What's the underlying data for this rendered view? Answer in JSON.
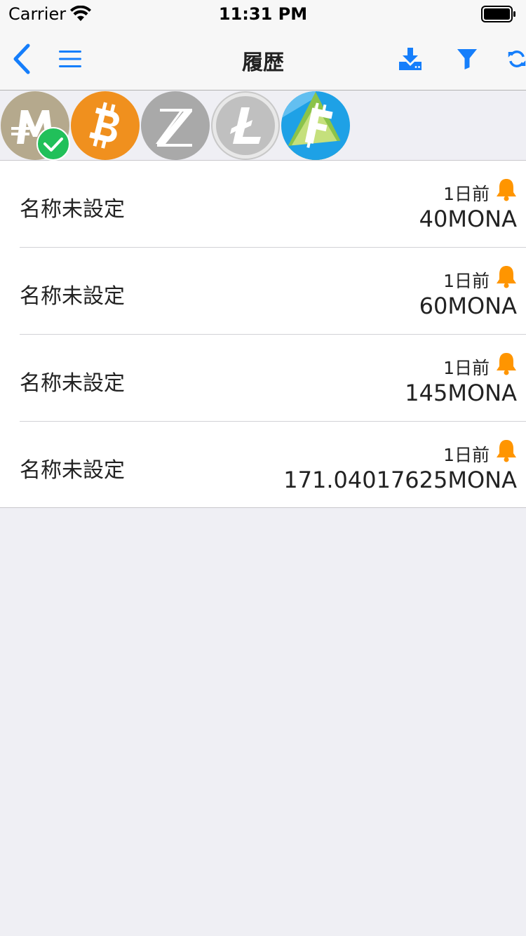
{
  "status_bar": {
    "carrier": "Carrier",
    "time": "11:31 PM",
    "wifi_icon": "wifi-icon",
    "battery_icon": "battery-icon"
  },
  "nav": {
    "title": "履歴",
    "accent_color": "#157efb",
    "left_icons": [
      "back-chevron-icon",
      "menu-icon"
    ],
    "right_icons": [
      "download-icon",
      "filter-icon",
      "refresh-icon"
    ]
  },
  "coins": [
    {
      "name": "monacoin-coin-icon",
      "color": "#b5a98d",
      "selected": true
    },
    {
      "name": "bitcoin-coin-icon",
      "color": "#f0901e",
      "selected": false
    },
    {
      "name": "bitzeny-coin-icon",
      "color": "#a9a9a9",
      "selected": false
    },
    {
      "name": "litecoin-coin-icon",
      "color": "#c0c0c0",
      "selected": false
    },
    {
      "name": "fujicoin-coin-icon",
      "color": "#1ea1e6",
      "selected": false
    }
  ],
  "history": [
    {
      "label": "名称未設定",
      "time": "1日前",
      "amount": "40MONA"
    },
    {
      "label": "名称未設定",
      "time": "1日前",
      "amount": "60MONA"
    },
    {
      "label": "名称未設定",
      "time": "1日前",
      "amount": "145MONA"
    },
    {
      "label": "名称未設定",
      "time": "1日前",
      "amount": "171.04017625MONA"
    }
  ],
  "colors": {
    "bell": "#ff9500",
    "check_badge": "#21c05a",
    "background": "#efeff4"
  }
}
